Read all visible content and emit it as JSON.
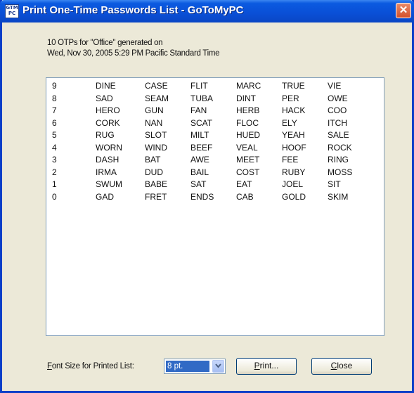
{
  "window": {
    "title": "Print One-Time Passwords List - GoToMyPC",
    "icon_text": "GTM PC",
    "close_glyph": "✕"
  },
  "info": {
    "line1": "10 OTPs for \"Office\" generated on",
    "line2": "Wed, Nov 30, 2005 5:29 PM Pacific Standard Time"
  },
  "passwords": [
    [
      "9",
      "DINE",
      "CASE",
      "FLIT",
      "MARC",
      "TRUE",
      "VIE"
    ],
    [
      "8",
      "SAD",
      "SEAM",
      "TUBA",
      "DINT",
      "PER",
      "OWE"
    ],
    [
      "7",
      "HERO",
      "GUN",
      "FAN",
      "HERB",
      "HACK",
      "COO"
    ],
    [
      "6",
      "CORK",
      "NAN",
      "SCAT",
      "FLOC",
      "ELY",
      "ITCH"
    ],
    [
      "5",
      "RUG",
      "SLOT",
      "MILT",
      "HUED",
      "YEAH",
      "SALE"
    ],
    [
      "4",
      "WORN",
      "WIND",
      "BEEF",
      "VEAL",
      "HOOF",
      "ROCK"
    ],
    [
      "3",
      "DASH",
      "BAT",
      "AWE",
      "MEET",
      "FEE",
      "RING"
    ],
    [
      "2",
      "IRMA",
      "DUD",
      "BAIL",
      "COST",
      "RUBY",
      "MOSS"
    ],
    [
      "1",
      "SWUM",
      "BABE",
      "SAT",
      "EAT",
      "JOEL",
      "SIT"
    ],
    [
      "0",
      "GAD",
      "FRET",
      "ENDS",
      "CAB",
      "GOLD",
      "SKIM"
    ]
  ],
  "footer": {
    "font_label_prefix": "F",
    "font_label_rest": "ont Size for Printed List:",
    "font_size_value": "8 pt.",
    "print_prefix": "P",
    "print_rest": "rint...",
    "close_prefix": "C",
    "close_rest": "lose"
  }
}
